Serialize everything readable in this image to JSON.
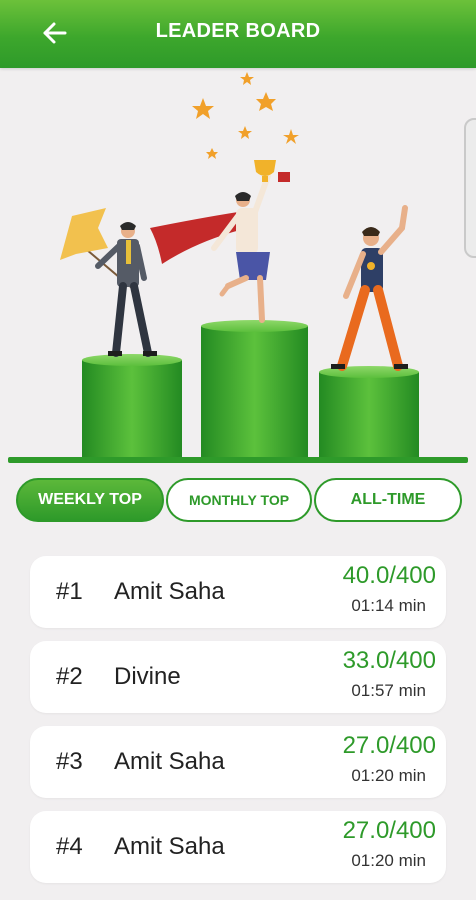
{
  "header": {
    "title": "LEADER BOARD",
    "back_icon": "arrow-left-icon",
    "background": "#3da72c"
  },
  "hero": {
    "illustration": "podium-winners-illustration"
  },
  "tabs": [
    {
      "label": "WEEKLY TOP",
      "active": true
    },
    {
      "label": "MONTHLY TOP",
      "active": false
    },
    {
      "label": "ALL-TIME",
      "active": false
    }
  ],
  "leaderboard": [
    {
      "rank": "#1",
      "name": "Amit Saha",
      "score": "40.0/400",
      "time": "01:14 min"
    },
    {
      "rank": "#2",
      "name": "Divine",
      "score": "33.0/400",
      "time": "01:57 min"
    },
    {
      "rank": "#3",
      "name": "Amit Saha",
      "score": "27.0/400",
      "time": "01:20 min"
    },
    {
      "rank": "#4",
      "name": "Amit Saha",
      "score": "27.0/400",
      "time": "01:20 min"
    }
  ],
  "colors": {
    "accent": "#2e9a2a",
    "background": "#f1eff0",
    "card": "#ffffff"
  }
}
